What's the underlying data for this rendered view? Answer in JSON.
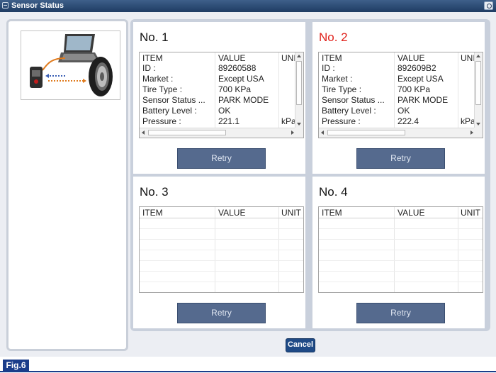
{
  "window": {
    "title": "Sensor Status"
  },
  "columns": {
    "item": "ITEM",
    "value": "VALUE",
    "unit": "UNIT",
    "unit_truncated": "UNI"
  },
  "sensors": [
    {
      "label": "No. 1",
      "label_color": "#111111",
      "rows": [
        {
          "item": "ID :",
          "value": "89260588",
          "unit": ""
        },
        {
          "item": "Market :",
          "value": "Except USA",
          "unit": ""
        },
        {
          "item": "Tire Type :",
          "value": "700 KPa",
          "unit": ""
        },
        {
          "item": "Sensor Status ...",
          "value": "PARK MODE",
          "unit": ""
        },
        {
          "item": "Battery Level :",
          "value": "OK",
          "unit": ""
        },
        {
          "item": "Pressure :",
          "value": "221.1",
          "unit": "kPa"
        }
      ],
      "retry_label": "Retry"
    },
    {
      "label": "No. 2",
      "label_color": "#e0211b",
      "rows": [
        {
          "item": "ID :",
          "value": "892609B2",
          "unit": ""
        },
        {
          "item": "Market :",
          "value": "Except USA",
          "unit": ""
        },
        {
          "item": "Tire Type :",
          "value": "700 KPa",
          "unit": ""
        },
        {
          "item": "Sensor Status ...",
          "value": "PARK MODE",
          "unit": ""
        },
        {
          "item": "Battery Level :",
          "value": "OK",
          "unit": ""
        },
        {
          "item": "Pressure :",
          "value": "222.4",
          "unit": "kPa"
        }
      ],
      "retry_label": "Retry"
    },
    {
      "label": "No. 3",
      "label_color": "#111111",
      "rows": [],
      "retry_label": "Retry"
    },
    {
      "label": "No. 4",
      "label_color": "#111111",
      "rows": [],
      "retry_label": "Retry"
    }
  ],
  "cancel_label": "Cancel",
  "figure_label": "Fig.6",
  "colors": {
    "titlebar": "#1f3c63",
    "retry_button": "#556a8e",
    "cancel_button": "#1f4a86",
    "figure_label": "#1a3d8a"
  }
}
